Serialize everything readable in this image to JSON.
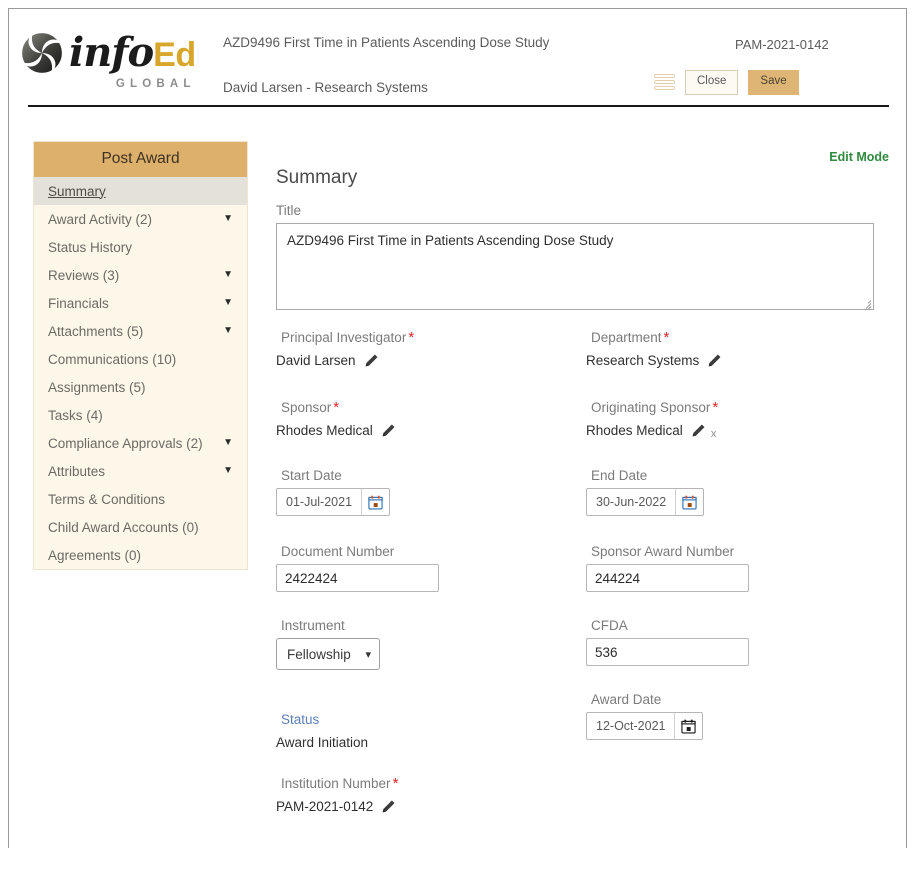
{
  "brand": {
    "logo_info": "info",
    "logo_ed": "Ed",
    "logo_global": "GLOBAL"
  },
  "header": {
    "study_title": "AZD9496 First Time in Patients Ascending Dose Study",
    "user_line": "David Larsen - Research Systems",
    "reference_number": "PAM-2021-0142",
    "menu_icon": "hamburger-icon",
    "close_label": "Close",
    "save_label": "Save"
  },
  "sidebar": {
    "heading": "Post Award",
    "items": [
      {
        "label": "Summary",
        "caret": "",
        "active": true
      },
      {
        "label": "Award Activity (2)",
        "caret": "▼",
        "active": false
      },
      {
        "label": "Status History",
        "caret": "",
        "active": false
      },
      {
        "label": "Reviews (3)",
        "caret": "▼",
        "active": false
      },
      {
        "label": "Financials",
        "caret": "▼",
        "active": false
      },
      {
        "label": "Attachments (5)",
        "caret": "▼",
        "active": false
      },
      {
        "label": "Communications (10)",
        "caret": "",
        "active": false
      },
      {
        "label": "Assignments (5)",
        "caret": "",
        "active": false
      },
      {
        "label": "Tasks (4)",
        "caret": "",
        "active": false
      },
      {
        "label": "Compliance Approvals (2)",
        "caret": "▼",
        "active": false
      },
      {
        "label": "Attributes",
        "caret": "▼",
        "active": false
      },
      {
        "label": "Terms & Conditions",
        "caret": "",
        "active": false
      },
      {
        "label": "Child Award Accounts (0)",
        "caret": "",
        "active": false
      },
      {
        "label": "Agreements (0)",
        "caret": "",
        "active": false
      }
    ]
  },
  "main": {
    "edit_mode_label": "Edit Mode",
    "section_title": "Summary",
    "title_label": "Title",
    "title_value": "AZD9496 First Time in Patients Ascending Dose Study",
    "pi_label": "Principal Investigator",
    "pi_value": "David Larsen",
    "department_label": "Department",
    "department_value": "Research Systems",
    "sponsor_label": "Sponsor",
    "sponsor_value": "Rhodes Medical",
    "orig_sponsor_label": "Originating Sponsor",
    "orig_sponsor_value": "Rhodes Medical",
    "orig_sponsor_clear": "x",
    "start_date_label": "Start Date",
    "start_date_value": "01-Jul-2021",
    "end_date_label": "End Date",
    "end_date_value": "30-Jun-2022",
    "document_number_label": "Document Number",
    "document_number_value": "2422424",
    "sponsor_award_number_label": "Sponsor Award Number",
    "sponsor_award_number_value": "244224",
    "instrument_label": "Instrument",
    "instrument_value": "Fellowship",
    "cfda_label": "CFDA",
    "cfda_value": "536",
    "status_label": "Status",
    "status_value": "Award Initiation",
    "award_date_label": "Award Date",
    "award_date_value": "12-Oct-2021",
    "institution_number_label": "Institution Number",
    "institution_number_value": "PAM-2021-0142",
    "required_marker": "*"
  },
  "colors": {
    "brand_gold": "#d9a62c",
    "sidebar_head": "#ddb06c",
    "save_button": "#deb575",
    "edit_mode_green": "#2f8a3e",
    "required_red": "#e02424"
  }
}
